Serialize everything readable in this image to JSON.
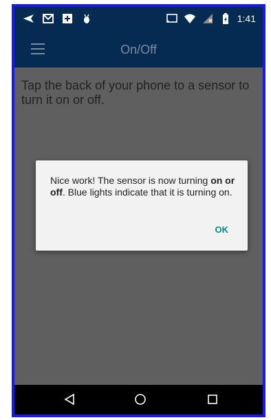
{
  "status_bar": {
    "time": "1:41",
    "left_icons": [
      "send-icon",
      "gmail-icon",
      "plus-box-icon",
      "bug-icon"
    ],
    "right_icons": [
      "cast-icon",
      "wifi-icon",
      "signal-icon",
      "battery-icon"
    ]
  },
  "app_bar": {
    "title": "On/Off",
    "menu_icon": "hamburger-icon"
  },
  "main": {
    "instruction": "Tap the back of your phone to a sensor to turn it on or off."
  },
  "dialog": {
    "message_part1": "Nice work! The sensor is now turning ",
    "message_bold": "on or off",
    "message_part2": ". Blue lights indicate that it is turning on.",
    "ok_label": "OK"
  },
  "nav_bar": {
    "buttons": [
      "back-icon",
      "home-icon",
      "recents-icon"
    ]
  },
  "colors": {
    "frame_border": "#1a1ae6",
    "app_bar": "#052b52",
    "background": "#5f5f5f",
    "dialog_bg": "#f2f2f2",
    "accent": "#0b8a7d"
  }
}
